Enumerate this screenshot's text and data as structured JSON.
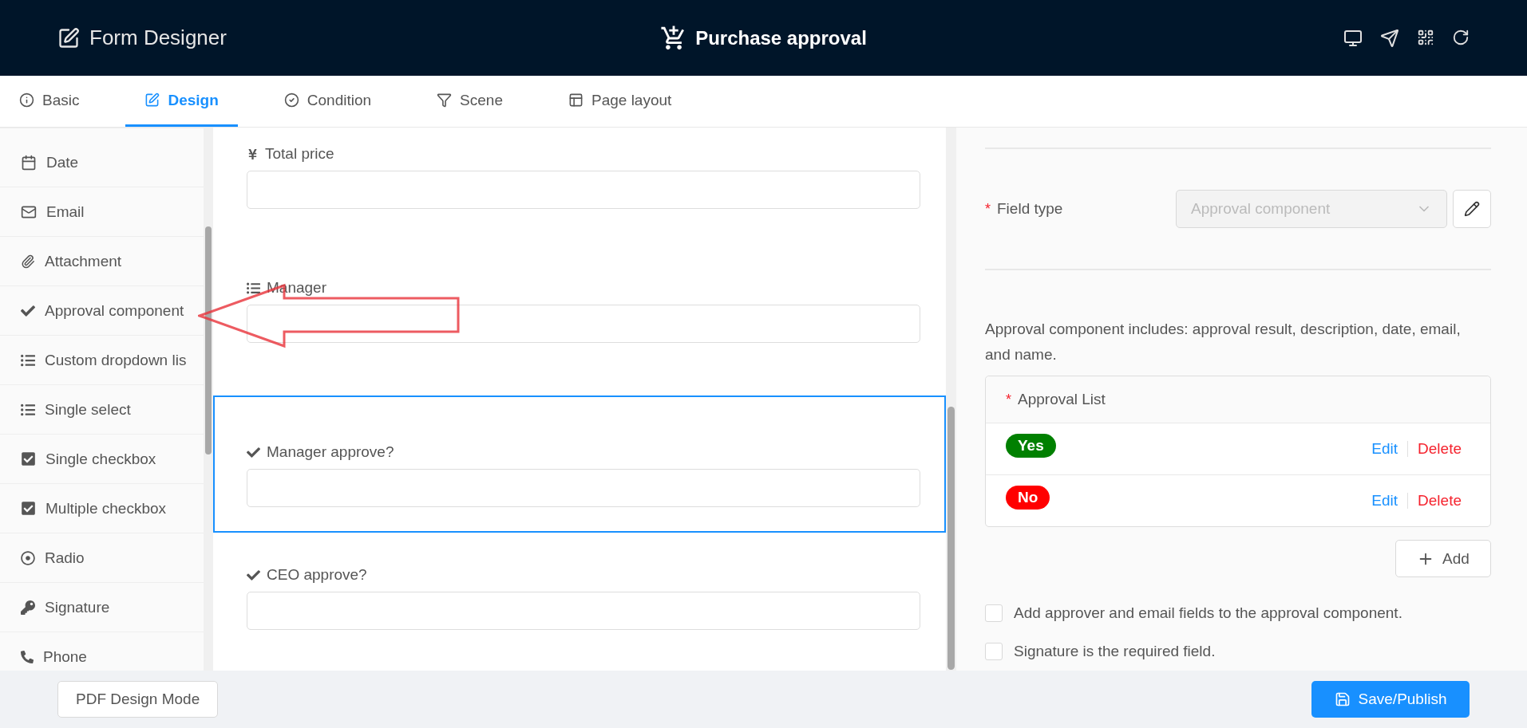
{
  "header": {
    "app_title": "Form Designer",
    "form_title": "Purchase approval"
  },
  "tabs": [
    {
      "label": "Basic",
      "selected": false
    },
    {
      "label": "Design",
      "selected": true
    },
    {
      "label": "Condition",
      "selected": false
    },
    {
      "label": "Scene",
      "selected": false
    },
    {
      "label": "Page layout",
      "selected": false
    }
  ],
  "sidebar": {
    "items": [
      "Date",
      "Email",
      "Attachment",
      "Approval component",
      "Custom dropdown lis",
      "Single select",
      "Single checkbox",
      "Multiple checkbox",
      "Radio",
      "Signature",
      "Phone"
    ]
  },
  "canvas": {
    "fields": [
      {
        "label": "Total price",
        "selected": false
      },
      {
        "label": "Manager",
        "selected": false
      },
      {
        "label": "Manager approve?",
        "selected": true
      },
      {
        "label": "CEO approve?",
        "selected": false
      }
    ]
  },
  "properties": {
    "field_type": {
      "required_mark": "*",
      "label": "Field type",
      "value": "Approval component"
    },
    "description": "Approval component includes: approval result, description, date, email, and name.",
    "approval_list": {
      "required_mark": "*",
      "title": "Approval List",
      "items": [
        {
          "label": "Yes",
          "color": "#008000",
          "edit": "Edit",
          "delete": "Delete"
        },
        {
          "label": "No",
          "color": "#ff0000",
          "edit": "Edit",
          "delete": "Delete"
        }
      ]
    },
    "add_button": "Add",
    "options": [
      {
        "label": "Add approver and email fields to the approval component.",
        "checked": false
      },
      {
        "label": "Signature is the required field.",
        "checked": false
      }
    ]
  },
  "footer": {
    "pdf_button": "PDF Design Mode",
    "save_button": "Save/Publish"
  }
}
